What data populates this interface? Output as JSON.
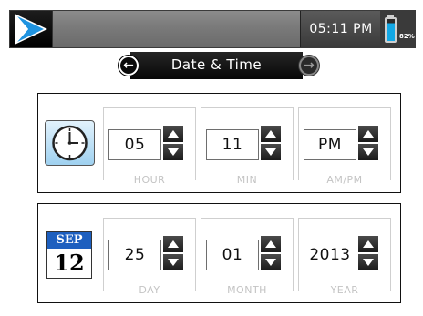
{
  "status_bar": {
    "time": "05:11 PM",
    "battery_percent": "82%",
    "battery_level": 0.82,
    "home_icon": "play-logo-icon"
  },
  "header": {
    "title": "Date & Time",
    "back_icon": "arrow-left-icon",
    "forward_icon": "arrow-right-icon"
  },
  "time_panel": {
    "icon": "clock-icon",
    "fields": [
      {
        "value": "05",
        "label": "HOUR"
      },
      {
        "value": "11",
        "label": "MIN"
      },
      {
        "value": "PM",
        "label": "AM/PM"
      }
    ]
  },
  "date_panel": {
    "icon": "calendar-icon",
    "icon_month": "SEP",
    "icon_day": "12",
    "fields": [
      {
        "value": "25",
        "label": "DAY"
      },
      {
        "value": "01",
        "label": "MONTH"
      },
      {
        "value": "2013",
        "label": "YEAR"
      }
    ]
  },
  "colors": {
    "battery_fill": "#12a8e6",
    "calendar_header": "#1d5fbf",
    "home_logo": "#1f93e0"
  }
}
